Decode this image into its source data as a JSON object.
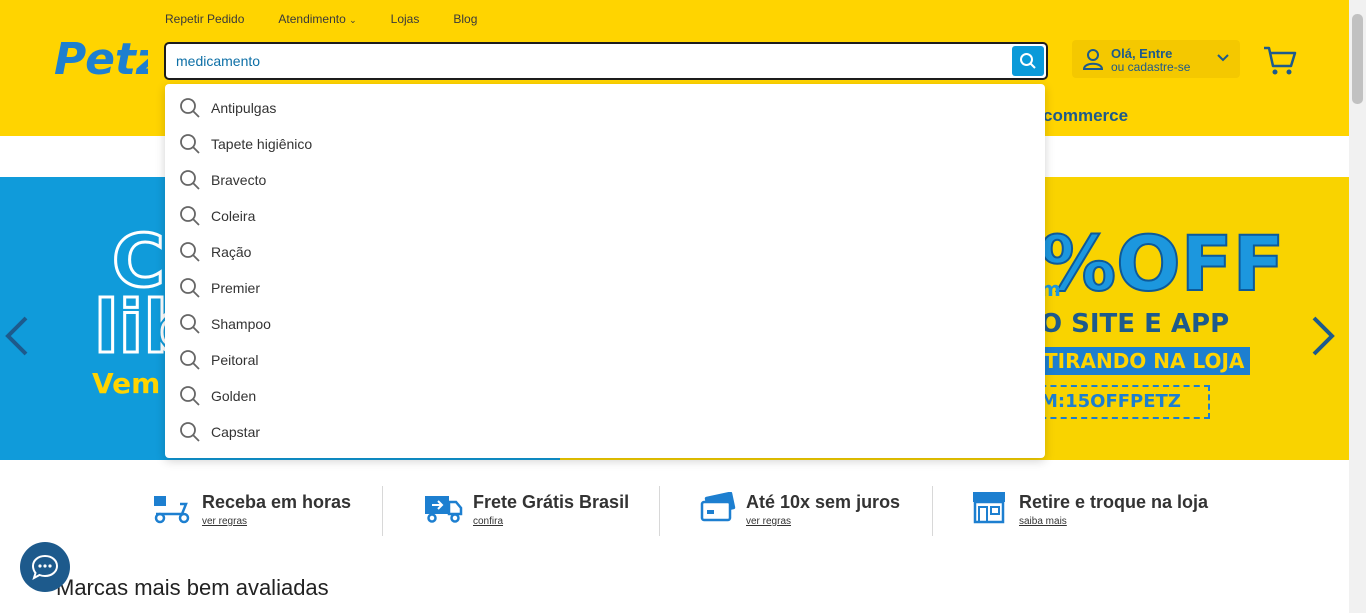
{
  "top_links": [
    "Repetir Pedido",
    "Atendimento",
    "Lojas",
    "Blog"
  ],
  "logo": {
    "text": "Petz",
    "icon": "petz-logo"
  },
  "search": {
    "value": "medicamento",
    "placeholder": "",
    "icon": "search-icon"
  },
  "account": {
    "line1": "Olá, Entre",
    "line2": "ou cadastre-se",
    "icon": "user-icon"
  },
  "cart": {
    "icon": "cart-icon"
  },
  "ecommerce_partial": "commerce",
  "suggestions": [
    "Antipulgas",
    "Tapete higiênico",
    "Bravecto",
    "Coleira",
    "Ração",
    "Premier",
    "Shampoo",
    "Peitoral",
    "Golden",
    "Capstar"
  ],
  "banner": {
    "left_fragments": [
      "C",
      "lib",
      "Vem"
    ],
    "right_lines": [
      "%OFF",
      "m",
      "O SITE E APP",
      "TIRANDO NA LOJA",
      "M:15OFFPETZ"
    ]
  },
  "features": [
    {
      "title": "Receba em horas",
      "link": "ver regras",
      "icon": "delivery-scooter-icon"
    },
    {
      "title": "Frete Grátis Brasil",
      "link": "confira",
      "icon": "truck-icon"
    },
    {
      "title": "Até 10x sem juros",
      "link": "ver regras",
      "icon": "credit-card-icon"
    },
    {
      "title": "Retire e troque na loja",
      "link": "saiba mais",
      "icon": "store-icon"
    }
  ],
  "section_title": "Marcas mais bem avaliadas",
  "colors": {
    "brand_yellow": "#FFD400",
    "brand_blue": "#1d5a8c",
    "accent_blue": "#0A9AD9"
  }
}
